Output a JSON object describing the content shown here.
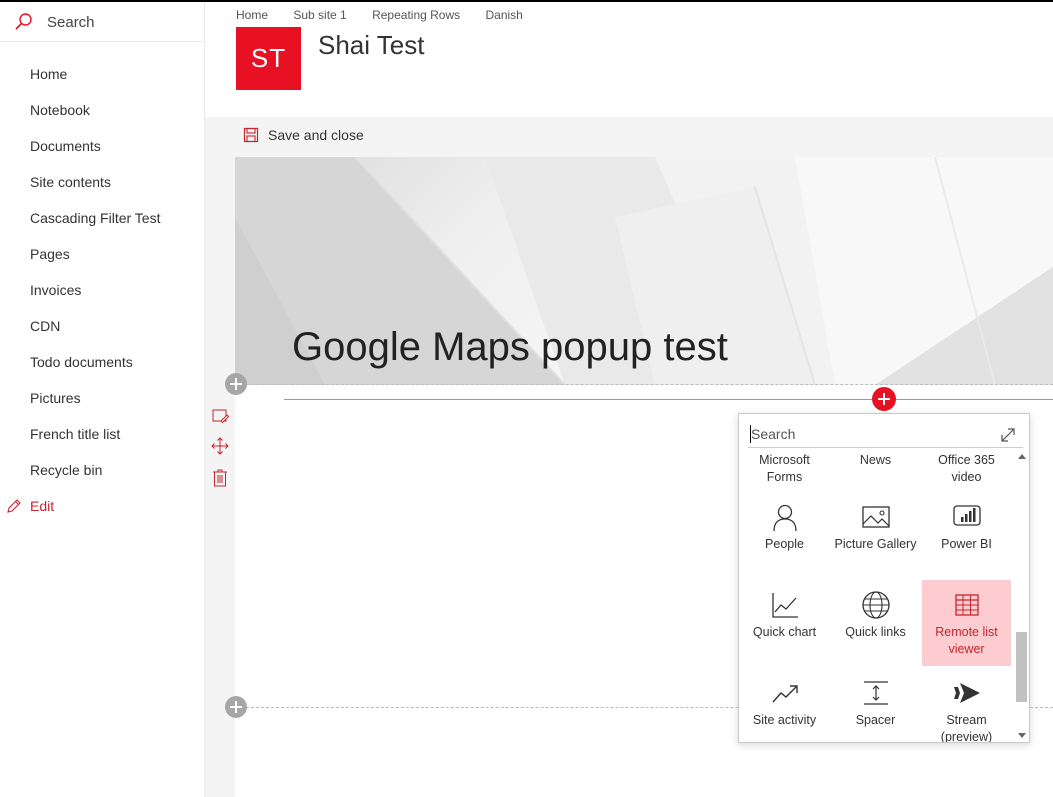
{
  "search": {
    "label": "Search"
  },
  "nav": {
    "items": [
      "Home",
      "Notebook",
      "Documents",
      "Site contents",
      "Cascading Filter Test",
      "Pages",
      "Invoices",
      "CDN",
      "Todo documents",
      "Pictures",
      "French title list",
      "Recycle bin"
    ],
    "edit_label": "Edit"
  },
  "header": {
    "breadcrumbs": [
      "Home",
      "Sub site 1",
      "Repeating Rows",
      "Danish"
    ],
    "logo_initials": "ST",
    "site_title": "Shai Test"
  },
  "toolbar": {
    "save_label": "Save and close"
  },
  "page": {
    "title": "Google Maps popup test"
  },
  "toolbox": {
    "search_placeholder": "Search",
    "tiles": [
      {
        "label": "Microsoft Forms",
        "icon": "none"
      },
      {
        "label": "News",
        "icon": "none"
      },
      {
        "label": "Office 365 video",
        "icon": "none"
      },
      {
        "label": "People",
        "icon": "person-icon"
      },
      {
        "label": "Picture Gallery",
        "icon": "picture-icon"
      },
      {
        "label": "Power BI",
        "icon": "power-bi-icon"
      },
      {
        "label": "Quick chart",
        "icon": "line-chart-icon"
      },
      {
        "label": "Quick links",
        "icon": "globe-icon"
      },
      {
        "label": "Remote list viewer",
        "icon": "table-icon",
        "selected": true
      },
      {
        "label": "Site activity",
        "icon": "trend-icon"
      },
      {
        "label": "Spacer",
        "icon": "spacer-icon"
      },
      {
        "label": "Stream (preview)",
        "icon": "stream-icon"
      }
    ]
  },
  "colors": {
    "accent": "#e81123",
    "accent_text": "#c4262e",
    "selected_bg": "#fdccd0"
  }
}
